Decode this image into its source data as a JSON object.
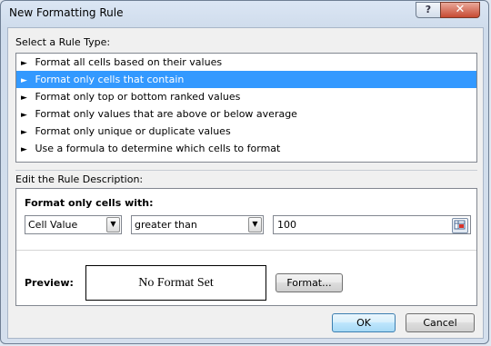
{
  "window": {
    "title": "New Formatting Rule",
    "help_glyph": "?",
    "close_glyph": "✕"
  },
  "rule_type": {
    "label": "Select a Rule Type:",
    "items": [
      {
        "label": "Format all cells based on their values"
      },
      {
        "label": "Format only cells that contain"
      },
      {
        "label": "Format only top or bottom ranked values"
      },
      {
        "label": "Format only values that are above or below average"
      },
      {
        "label": "Format only unique or duplicate values"
      },
      {
        "label": "Use a formula to determine which cells to format"
      }
    ],
    "selected_index": 1,
    "bullet": "►"
  },
  "description": {
    "label": "Edit the Rule Description:",
    "format_heading": "Format only cells with:",
    "condition_field": "Cell Value",
    "operator": "greater than",
    "value": "100",
    "preview_label": "Preview:",
    "preview_text": "No Format Set",
    "format_button": "Format..."
  },
  "buttons": {
    "ok": "OK",
    "cancel": "Cancel"
  },
  "colors": {
    "selection": "#3399ff",
    "titlebar": "#dbe6f4",
    "close_button": "#c74a32"
  }
}
